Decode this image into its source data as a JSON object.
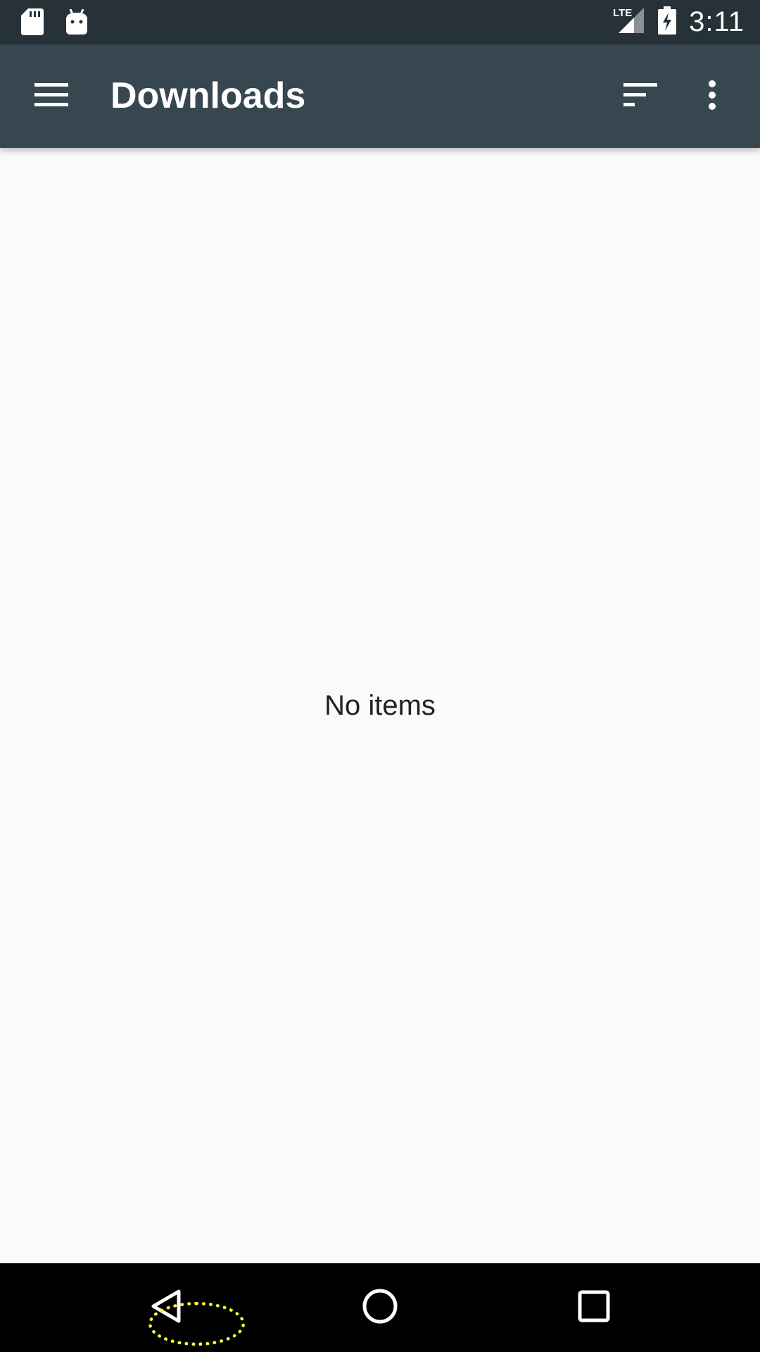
{
  "status_bar": {
    "left_icons": [
      "sd-card-icon",
      "android-debug-icon"
    ],
    "network_label": "LTE",
    "time": "3:11",
    "right_icons": [
      "lte-signal-icon",
      "battery-charging-icon"
    ]
  },
  "app_bar": {
    "title": "Downloads",
    "icons": [
      "menu-icon",
      "sort-icon",
      "more-vert-icon"
    ]
  },
  "content": {
    "empty_message": "No items"
  },
  "nav_bar": {
    "icons": [
      "back-icon",
      "home-icon",
      "recents-icon"
    ]
  },
  "colors": {
    "status_bar": "#263238",
    "app_bar": "#37474f",
    "background": "#fafafa",
    "nav_bar": "#000000",
    "tap_marker": "#ffff33"
  }
}
